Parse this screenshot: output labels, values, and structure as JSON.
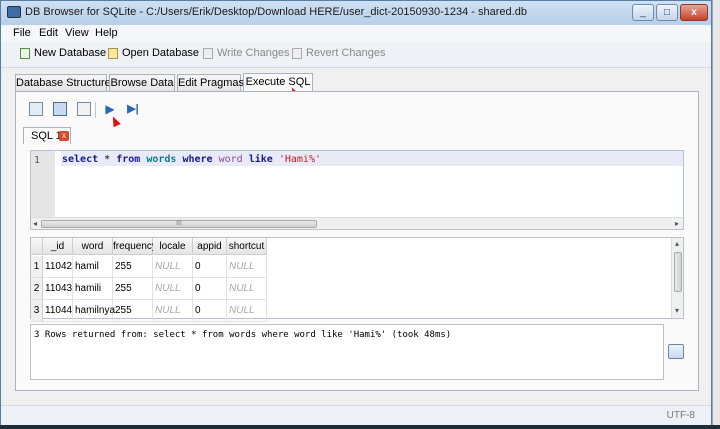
{
  "window": {
    "title": "DB Browser for SQLite - C:/Users/Erik/Desktop/Download HERE/user_dict-20150930-1234 - shared.db",
    "minimize": "_",
    "maximize": "□",
    "close": "x"
  },
  "menu": [
    "File",
    "Edit",
    "View",
    "Help"
  ],
  "toolbar": {
    "new_db": "New Database",
    "open_db": "Open Database",
    "write_changes": "Write Changes",
    "revert_changes": "Revert Changes"
  },
  "tabs": [
    "Database Structure",
    "Browse Data",
    "Edit Pragmas",
    "Execute SQL"
  ],
  "active_tab": "Execute SQL",
  "sql_tab": {
    "label": "SQL 1",
    "close": "x"
  },
  "editor": {
    "line_number": "1",
    "tokens": {
      "select": "select",
      "star": " * ",
      "from": "from",
      "table": "words",
      "where": "where",
      "column": "word",
      "like": "like",
      "pattern": "'Hami%'"
    },
    "scroll_grip": "III"
  },
  "results": {
    "columns": [
      "_id",
      "word",
      "frequency",
      "locale",
      "appid",
      "shortcut"
    ],
    "rows": [
      {
        "n": "1",
        "cells": [
          "11042",
          "hamil",
          "255",
          "NULL",
          "0",
          "NULL"
        ]
      },
      {
        "n": "2",
        "cells": [
          "11043",
          "hamili",
          "255",
          "NULL",
          "0",
          "NULL"
        ]
      },
      {
        "n": "3",
        "cells": [
          "11044",
          "hamilnya",
          "255",
          "NULL",
          "0",
          "NULL"
        ]
      }
    ]
  },
  "message": "3 Rows returned from: select * from words where word like 'Hami%' (took 48ms)",
  "status": {
    "encoding": "UTF-8"
  },
  "colors": {
    "accent": "#2a67b7",
    "string": "#c21d1d",
    "cursor": "#e01010"
  }
}
